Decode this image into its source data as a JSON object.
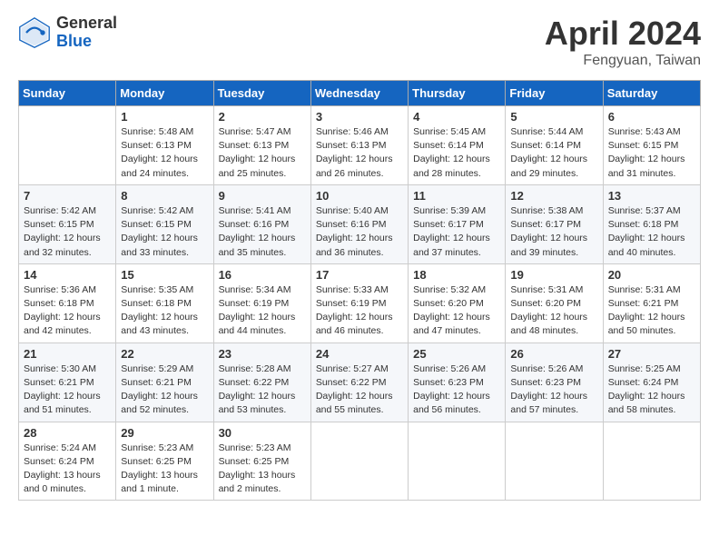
{
  "logo": {
    "general": "General",
    "blue": "Blue"
  },
  "title": "April 2024",
  "location": "Fengyuan, Taiwan",
  "days_of_week": [
    "Sunday",
    "Monday",
    "Tuesday",
    "Wednesday",
    "Thursday",
    "Friday",
    "Saturday"
  ],
  "weeks": [
    [
      {
        "day": "",
        "info": ""
      },
      {
        "day": "1",
        "info": "Sunrise: 5:48 AM\nSunset: 6:13 PM\nDaylight: 12 hours\nand 24 minutes."
      },
      {
        "day": "2",
        "info": "Sunrise: 5:47 AM\nSunset: 6:13 PM\nDaylight: 12 hours\nand 25 minutes."
      },
      {
        "day": "3",
        "info": "Sunrise: 5:46 AM\nSunset: 6:13 PM\nDaylight: 12 hours\nand 26 minutes."
      },
      {
        "day": "4",
        "info": "Sunrise: 5:45 AM\nSunset: 6:14 PM\nDaylight: 12 hours\nand 28 minutes."
      },
      {
        "day": "5",
        "info": "Sunrise: 5:44 AM\nSunset: 6:14 PM\nDaylight: 12 hours\nand 29 minutes."
      },
      {
        "day": "6",
        "info": "Sunrise: 5:43 AM\nSunset: 6:15 PM\nDaylight: 12 hours\nand 31 minutes."
      }
    ],
    [
      {
        "day": "7",
        "info": "Sunrise: 5:42 AM\nSunset: 6:15 PM\nDaylight: 12 hours\nand 32 minutes."
      },
      {
        "day": "8",
        "info": "Sunrise: 5:42 AM\nSunset: 6:15 PM\nDaylight: 12 hours\nand 33 minutes."
      },
      {
        "day": "9",
        "info": "Sunrise: 5:41 AM\nSunset: 6:16 PM\nDaylight: 12 hours\nand 35 minutes."
      },
      {
        "day": "10",
        "info": "Sunrise: 5:40 AM\nSunset: 6:16 PM\nDaylight: 12 hours\nand 36 minutes."
      },
      {
        "day": "11",
        "info": "Sunrise: 5:39 AM\nSunset: 6:17 PM\nDaylight: 12 hours\nand 37 minutes."
      },
      {
        "day": "12",
        "info": "Sunrise: 5:38 AM\nSunset: 6:17 PM\nDaylight: 12 hours\nand 39 minutes."
      },
      {
        "day": "13",
        "info": "Sunrise: 5:37 AM\nSunset: 6:18 PM\nDaylight: 12 hours\nand 40 minutes."
      }
    ],
    [
      {
        "day": "14",
        "info": "Sunrise: 5:36 AM\nSunset: 6:18 PM\nDaylight: 12 hours\nand 42 minutes."
      },
      {
        "day": "15",
        "info": "Sunrise: 5:35 AM\nSunset: 6:18 PM\nDaylight: 12 hours\nand 43 minutes."
      },
      {
        "day": "16",
        "info": "Sunrise: 5:34 AM\nSunset: 6:19 PM\nDaylight: 12 hours\nand 44 minutes."
      },
      {
        "day": "17",
        "info": "Sunrise: 5:33 AM\nSunset: 6:19 PM\nDaylight: 12 hours\nand 46 minutes."
      },
      {
        "day": "18",
        "info": "Sunrise: 5:32 AM\nSunset: 6:20 PM\nDaylight: 12 hours\nand 47 minutes."
      },
      {
        "day": "19",
        "info": "Sunrise: 5:31 AM\nSunset: 6:20 PM\nDaylight: 12 hours\nand 48 minutes."
      },
      {
        "day": "20",
        "info": "Sunrise: 5:31 AM\nSunset: 6:21 PM\nDaylight: 12 hours\nand 50 minutes."
      }
    ],
    [
      {
        "day": "21",
        "info": "Sunrise: 5:30 AM\nSunset: 6:21 PM\nDaylight: 12 hours\nand 51 minutes."
      },
      {
        "day": "22",
        "info": "Sunrise: 5:29 AM\nSunset: 6:21 PM\nDaylight: 12 hours\nand 52 minutes."
      },
      {
        "day": "23",
        "info": "Sunrise: 5:28 AM\nSunset: 6:22 PM\nDaylight: 12 hours\nand 53 minutes."
      },
      {
        "day": "24",
        "info": "Sunrise: 5:27 AM\nSunset: 6:22 PM\nDaylight: 12 hours\nand 55 minutes."
      },
      {
        "day": "25",
        "info": "Sunrise: 5:26 AM\nSunset: 6:23 PM\nDaylight: 12 hours\nand 56 minutes."
      },
      {
        "day": "26",
        "info": "Sunrise: 5:26 AM\nSunset: 6:23 PM\nDaylight: 12 hours\nand 57 minutes."
      },
      {
        "day": "27",
        "info": "Sunrise: 5:25 AM\nSunset: 6:24 PM\nDaylight: 12 hours\nand 58 minutes."
      }
    ],
    [
      {
        "day": "28",
        "info": "Sunrise: 5:24 AM\nSunset: 6:24 PM\nDaylight: 13 hours\nand 0 minutes."
      },
      {
        "day": "29",
        "info": "Sunrise: 5:23 AM\nSunset: 6:25 PM\nDaylight: 13 hours\nand 1 minute."
      },
      {
        "day": "30",
        "info": "Sunrise: 5:23 AM\nSunset: 6:25 PM\nDaylight: 13 hours\nand 2 minutes."
      },
      {
        "day": "",
        "info": ""
      },
      {
        "day": "",
        "info": ""
      },
      {
        "day": "",
        "info": ""
      },
      {
        "day": "",
        "info": ""
      }
    ]
  ]
}
